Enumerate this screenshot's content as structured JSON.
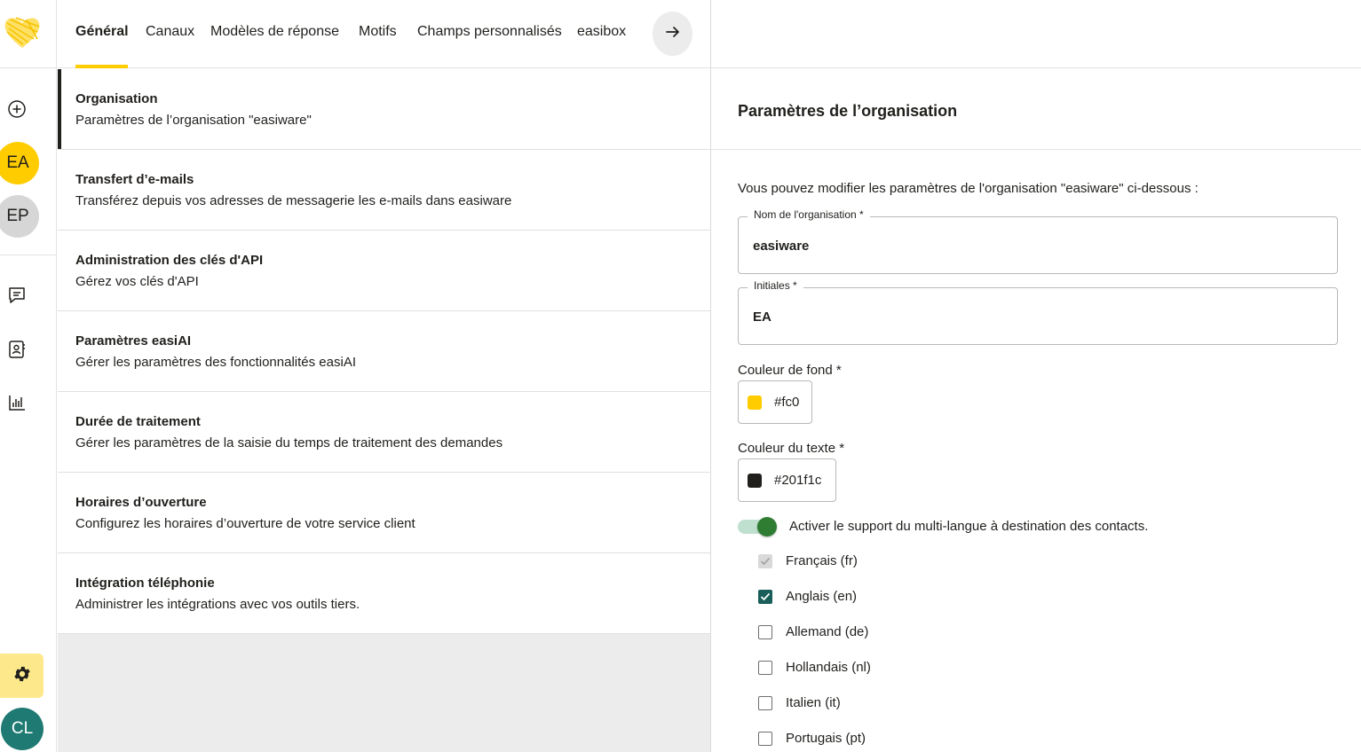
{
  "tabs": [
    {
      "label": "Général",
      "active": true
    },
    {
      "label": "Canaux"
    },
    {
      "label": "Modèles de réponse"
    },
    {
      "label": "Motifs"
    },
    {
      "label": "Champs personnalisés"
    },
    {
      "label": "easibox"
    }
  ],
  "rail": {
    "avatars": [
      {
        "initials": "EA",
        "bg": "#ffcc00",
        "color": "#201f1c"
      },
      {
        "initials": "EP",
        "bg": "#d6d6d6",
        "color": "#201f1c"
      },
      {
        "initials": "CL",
        "bg": "#1f7a73",
        "color": "#ffffff"
      }
    ],
    "icons": [
      "add-circle-icon",
      "chat-icon",
      "contacts-icon",
      "stats-icon",
      "settings-gear-icon"
    ]
  },
  "settings_list": [
    {
      "title": "Organisation",
      "subtitle": "Paramètres de l’organisation \"easiware\"",
      "active": true
    },
    {
      "title": "Transfert d’e-mails",
      "subtitle": "Transférez depuis vos adresses de messagerie les e-mails dans easiware"
    },
    {
      "title": "Administration des clés d'API",
      "subtitle": "Gérez vos clés d'API"
    },
    {
      "title": "Paramètres easiAI",
      "subtitle": "Gérer les paramètres des fonctionnalités easiAI"
    },
    {
      "title": "Durée de traitement",
      "subtitle": "Gérer les paramètres de la saisie du temps de traitement des demandes"
    },
    {
      "title": "Horaires d’ouverture",
      "subtitle": "Configurez les horaires d’ouverture de votre service client"
    },
    {
      "title": "Intégration téléphonie",
      "subtitle": "Administrer les intégrations avec vos outils tiers."
    }
  ],
  "panel": {
    "title": "Paramètres de l’organisation",
    "intro": "Vous pouvez modifier les paramètres de l'organisation \"easiware\" ci-dessous :",
    "org_name": {
      "label": "Nom de l'organisation *",
      "value": "easiware"
    },
    "initials": {
      "label": "Initiales *",
      "value": "EA"
    },
    "bg_color": {
      "label": "Couleur de fond *",
      "value": "#fc0",
      "swatch": "#ffcc00"
    },
    "text_color": {
      "label": "Couleur du texte *",
      "value": "#201f1c",
      "swatch": "#201f1c"
    },
    "multilang": {
      "label": "Activer le support du multi-langue à destination des contacts.",
      "enabled": true
    },
    "languages": [
      {
        "label": "Français (fr)",
        "checked": true,
        "disabled": true
      },
      {
        "label": "Anglais (en)",
        "checked": true
      },
      {
        "label": "Allemand (de)",
        "checked": false
      },
      {
        "label": "Hollandais (nl)",
        "checked": false
      },
      {
        "label": "Italien (it)",
        "checked": false
      },
      {
        "label": "Portugais (pt)",
        "checked": false
      }
    ]
  }
}
